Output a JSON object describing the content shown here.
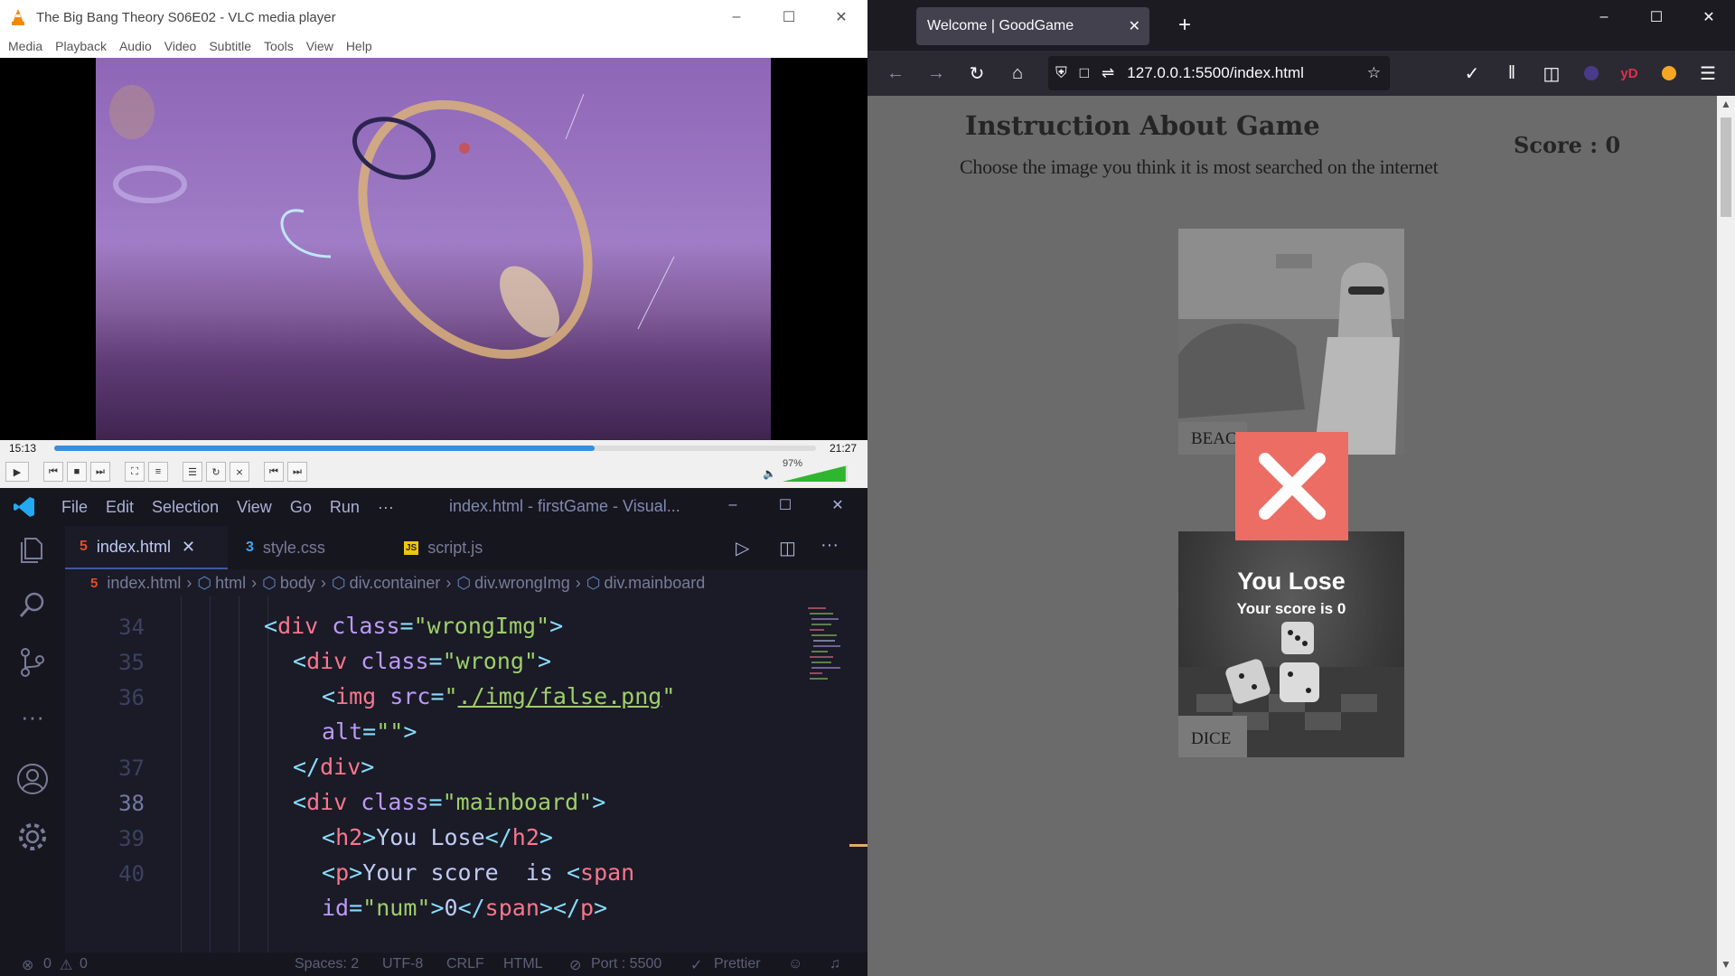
{
  "vlc": {
    "title": "The Big Bang Theory S06E02 - VLC media player",
    "menu": [
      "Media",
      "Playback",
      "Audio",
      "Video",
      "Subtitle",
      "Tools",
      "View",
      "Help"
    ],
    "time_elapsed": "15:13",
    "time_total": "21:27",
    "progress_fraction": 0.709,
    "volume_label": "97%",
    "volume_fraction": 0.97
  },
  "vscode": {
    "menu": [
      "File",
      "Edit",
      "Selection",
      "View",
      "Go",
      "Run",
      "···"
    ],
    "window_title": "index.html - firstGame - Visual...",
    "tabs": [
      {
        "label": "index.html",
        "active": true
      },
      {
        "label": "style.css",
        "active": false
      },
      {
        "label": "script.js",
        "active": false
      }
    ],
    "breadcrumb": [
      "index.html",
      "html",
      "body",
      "div.container",
      "div.wrongImg",
      "div.mainboard"
    ],
    "line_numbers": [
      "34",
      "35",
      "36",
      "",
      "37",
      "38",
      "39",
      "40",
      ""
    ],
    "status": {
      "errors": "0",
      "warnings": "0",
      "spaces": "Spaces: 2",
      "encoding": "UTF-8",
      "eol": "CRLF",
      "language": "HTML",
      "port": "Port : 5500",
      "formatter": "Prettier"
    }
  },
  "firefox": {
    "tab_title": "Welcome | GoodGame",
    "url": "127.0.0.1:5500/index.html",
    "page": {
      "title": "Instruction About Game",
      "subtitle": "Choose the image you think it is most searched on the internet",
      "score": "Score : 0",
      "card1_label": "BEACH",
      "card2_label": "DICE",
      "lose_heading": "You Lose",
      "lose_text": "Your score is 0"
    }
  },
  "colors": {
    "vlc_accent": "#3a8ddc",
    "vscode_bg": "#1a1b26",
    "firefox_toolbar": "#2b2a33",
    "lose_red": "#ec6d64"
  }
}
